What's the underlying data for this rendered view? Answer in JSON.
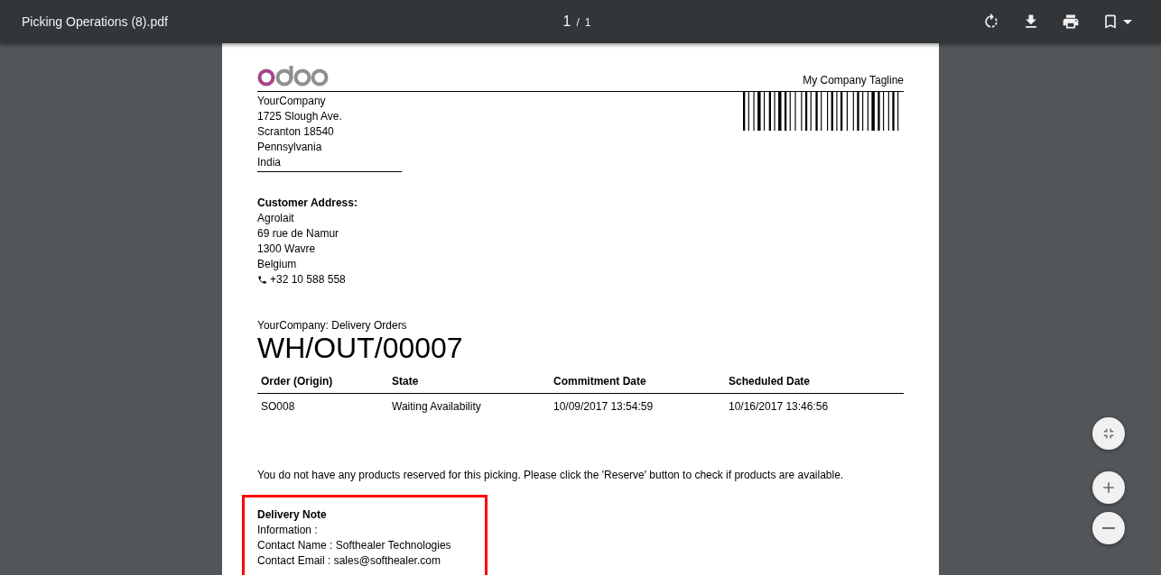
{
  "toolbar": {
    "title": "Picking Operations (8).pdf",
    "page_current": "1",
    "page_separator": "/",
    "page_total": "1"
  },
  "document": {
    "tagline": "My Company Tagline",
    "company_address": [
      "YourCompany",
      "1725 Slough Ave.",
      "Scranton 18540",
      "Pennsylvania",
      "India"
    ],
    "customer_heading": "Customer Address:",
    "customer_address": [
      "Agrolait",
      "69 rue de Namur",
      "1300 Wavre",
      "Belgium"
    ],
    "customer_phone": "+32 10 588 558",
    "picking_type": "YourCompany: Delivery Orders",
    "reference": "WH/OUT/00007",
    "table": {
      "columns": [
        "Order (Origin)",
        "State",
        "Commitment Date",
        "Scheduled Date"
      ],
      "rows": [
        [
          "SO008",
          "Waiting Availability",
          "10/09/2017 13:54:59",
          "10/16/2017 13:46:56"
        ]
      ]
    },
    "message": "You do not have any products reserved for this picking. Please click the 'Reserve' button to check if products are available.",
    "delivery_note": {
      "highlighted": true,
      "heading": "Delivery Note",
      "lines": [
        "Information :",
        "Contact Name : Softhealer Technologies",
        "Contact Email : sales@softhealer.com"
      ]
    }
  }
}
